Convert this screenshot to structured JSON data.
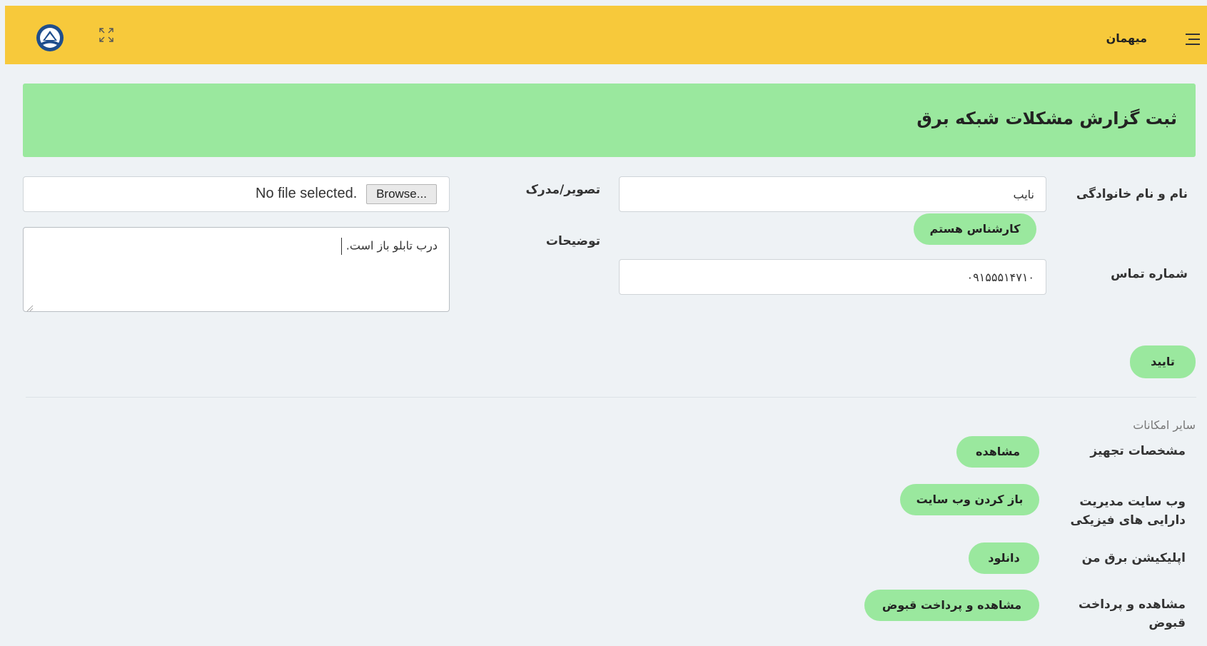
{
  "header": {
    "user_name": "میهمان",
    "logo_icon": "company-logo",
    "expand_icon": "expand-icon",
    "menu_icon": "hamburger-icon"
  },
  "page_title": "ثبت گزارش مشکلات شبکه برق",
  "form": {
    "name_label": "نام و نام خانوادگی",
    "name_value": "نایب",
    "expert_button": "کارشناس هستم",
    "phone_label": "شماره تماس",
    "phone_value": "۰۹۱۵۵۵۱۴۷۱۰",
    "image_label": "تصویر/مدرک",
    "browse_label": "Browse...",
    "file_status": "No file selected.",
    "description_label": "توضیحات",
    "description_value": "درب تابلو باز است.",
    "submit_button": "تایید"
  },
  "other_features": {
    "title": "سایر امکانات",
    "items": [
      {
        "label": "مشخصات تجهیز",
        "button": "مشاهده"
      },
      {
        "label_line1": "وب سایت مدیریت",
        "label_line2": "دارایی های فیزیکی",
        "button": "باز کردن وب سایت"
      },
      {
        "label": "اپلیکیشن برق من",
        "button": "دانلود"
      },
      {
        "label_line1": "مشاهده و پرداخت",
        "label_line2": "قبوض",
        "button": "مشاهده و پرداخت قبوض"
      }
    ]
  },
  "colors": {
    "header_bg": "#f7c93b",
    "accent_green": "#9ae89e",
    "page_bg": "#eef2f5"
  }
}
